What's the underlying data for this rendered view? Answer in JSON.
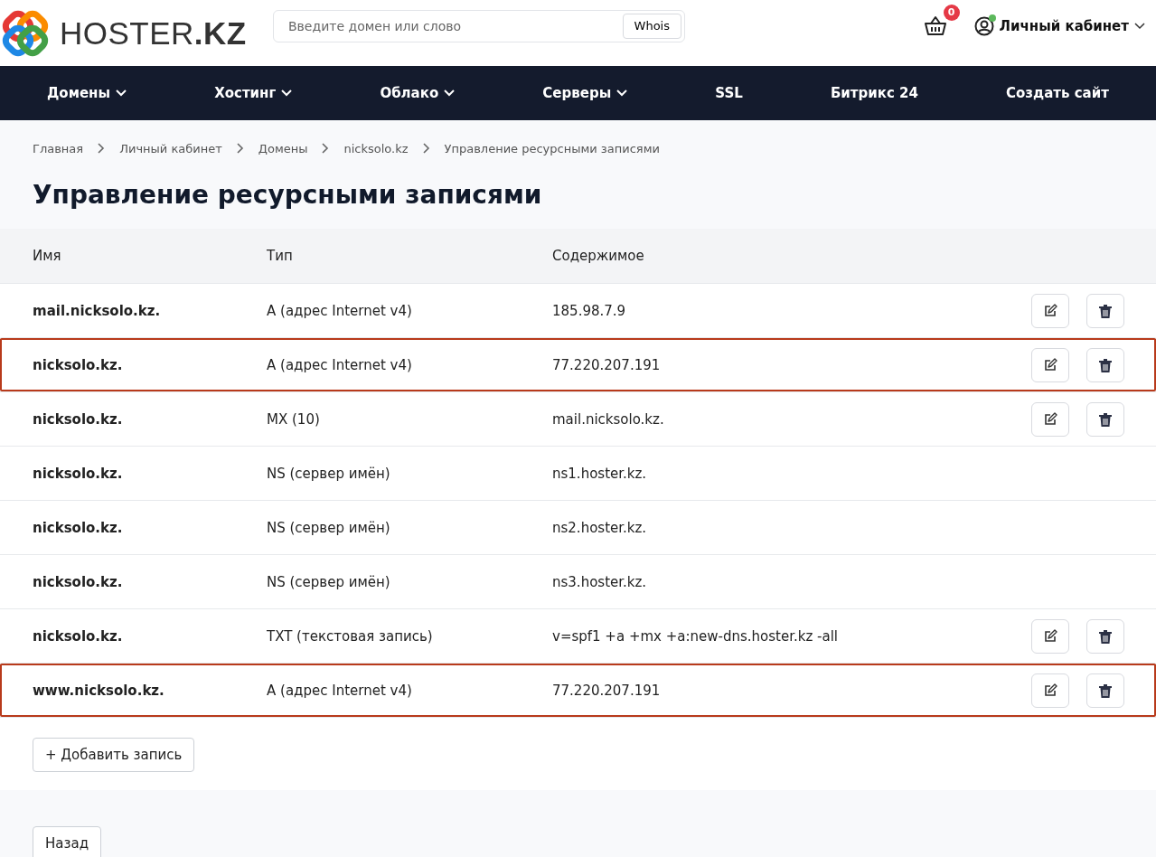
{
  "header": {
    "logo_text": "HOSTER",
    "logo_bold": ".KZ",
    "search": {
      "placeholder": "Введите домен или слово",
      "button": "Whois"
    },
    "cart_count": "0",
    "account": {
      "label": "Личный кабинет",
      "online": true
    }
  },
  "nav": [
    {
      "label": "Домены",
      "dropdown": true
    },
    {
      "label": "Хостинг",
      "dropdown": true
    },
    {
      "label": "Облако",
      "dropdown": true
    },
    {
      "label": "Серверы",
      "dropdown": true
    },
    {
      "label": "SSL",
      "dropdown": false
    },
    {
      "label": "Битрикс 24",
      "dropdown": false
    },
    {
      "label": "Создать сайт",
      "dropdown": false
    }
  ],
  "breadcrumbs": [
    "Главная",
    "Личный кабинет",
    "Домены",
    "nicksolo.kz",
    "Управление ресурсными записями"
  ],
  "title": "Управление ресурсными записями",
  "table": {
    "columns": [
      "Имя",
      "Тип",
      "Содержимое"
    ],
    "rows": [
      {
        "name": "mail.nicksolo.kz.",
        "type": "A (адрес Internet v4)",
        "content": "185.98.7.9",
        "editable": true,
        "highlighted": false
      },
      {
        "name": "nicksolo.kz.",
        "type": "A (адрес Internet v4)",
        "content": "77.220.207.191",
        "editable": true,
        "highlighted": true
      },
      {
        "name": "nicksolo.kz.",
        "type": "MX (10)",
        "content": "mail.nicksolo.kz.",
        "editable": true,
        "highlighted": false
      },
      {
        "name": "nicksolo.kz.",
        "type": "NS (сервер имён)",
        "content": "ns1.hoster.kz.",
        "editable": false,
        "highlighted": false
      },
      {
        "name": "nicksolo.kz.",
        "type": "NS (сервер имён)",
        "content": "ns2.hoster.kz.",
        "editable": false,
        "highlighted": false
      },
      {
        "name": "nicksolo.kz.",
        "type": "NS (сервер имён)",
        "content": "ns3.hoster.kz.",
        "editable": false,
        "highlighted": false
      },
      {
        "name": "nicksolo.kz.",
        "type": "TXT (текстовая запись)",
        "content": "v=spf1 +a +mx +a:new-dns.hoster.kz -all",
        "editable": true,
        "highlighted": false
      },
      {
        "name": "www.nicksolo.kz.",
        "type": "A (адрес Internet v4)",
        "content": "77.220.207.191",
        "editable": true,
        "highlighted": true
      }
    ],
    "add_button": "+ Добавить запись"
  },
  "back_button": "Назад"
}
